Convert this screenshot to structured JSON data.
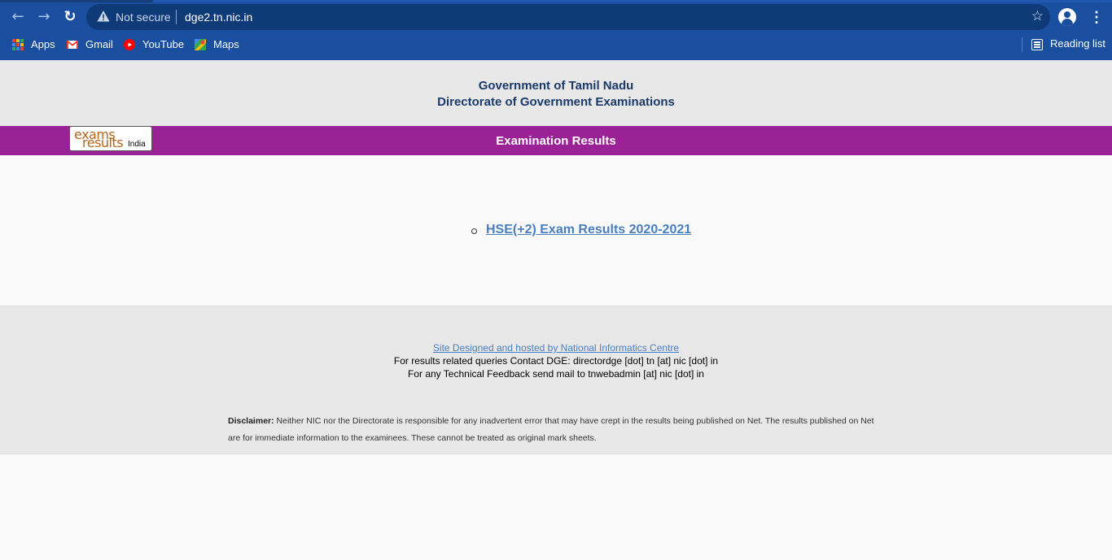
{
  "browser": {
    "security_label": "Not secure",
    "url": "dge2.tn.nic.in",
    "bookmarks": [
      {
        "label": "Apps",
        "icon": "apps-grid-icon"
      },
      {
        "label": "Gmail",
        "icon": "gmail-icon"
      },
      {
        "label": "YouTube",
        "icon": "youtube-icon"
      },
      {
        "label": "Maps",
        "icon": "maps-icon"
      }
    ],
    "reading_list_label": "Reading list",
    "colors": {
      "chrome": "#1a4fa0",
      "omnibox": "#0f3a78"
    }
  },
  "header": {
    "line1": "Government of Tamil Nadu",
    "line2": "Directorate of Government Examinations"
  },
  "banner": {
    "logo_top": "exams",
    "logo_bottom": "results",
    "logo_suffix": "India",
    "title": "Examination Results",
    "color": "#9b2196"
  },
  "results": {
    "items": [
      {
        "label": "HSE(+2) Exam Results 2020-2021"
      }
    ]
  },
  "footer": {
    "nic_link": "Site Designed and hosted by National Informatics Centre",
    "contact": "For results related queries Contact DGE:  directordge [dot] tn [at] nic [dot] in",
    "tech": "For any Technical Feedback send mail to tnwebadmin [at] nic [dot] in",
    "disclaimer_label": "Disclaimer:",
    "disclaimer_text": " Neither NIC nor the Directorate is responsible for any inadvertent error that may have crept in the results being published on Net. The results published on Net are for immediate information to the examinees. These cannot be treated as original mark sheets."
  }
}
